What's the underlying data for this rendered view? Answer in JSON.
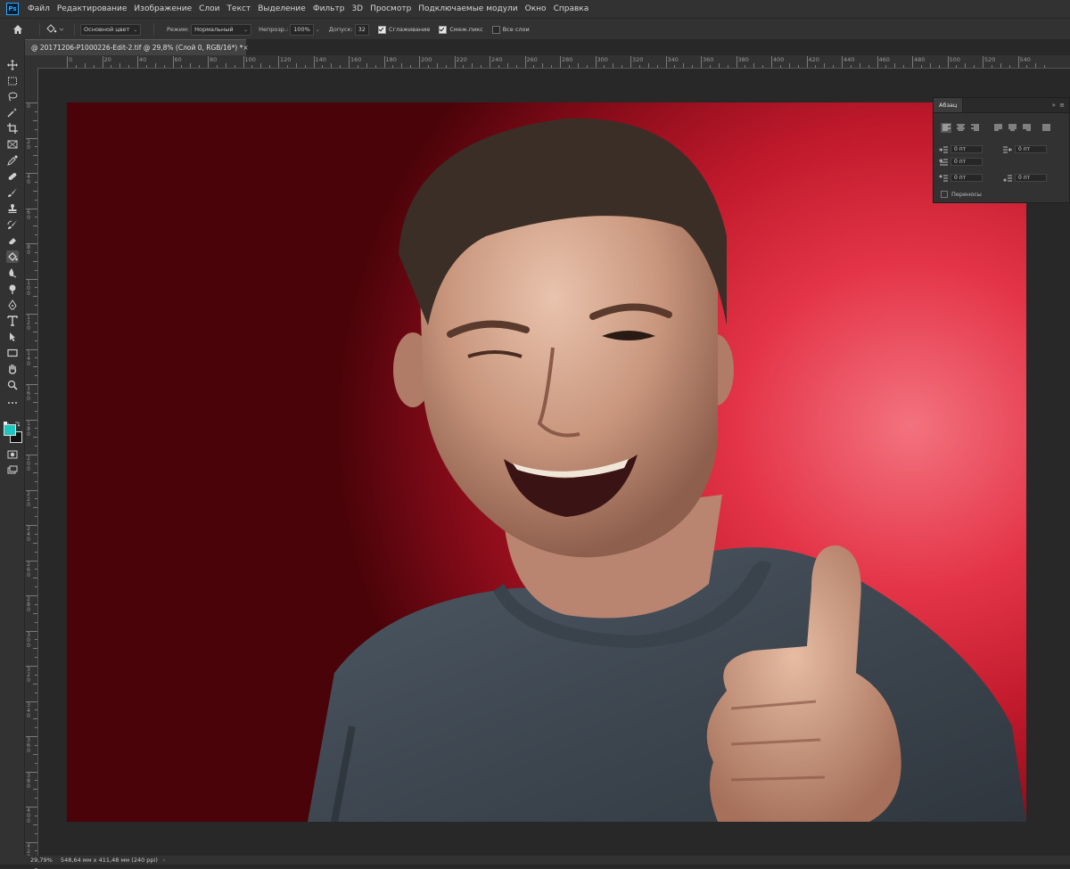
{
  "app": {
    "logo": "Ps"
  },
  "menu": [
    "Файл",
    "Редактирование",
    "Изображение",
    "Слои",
    "Текст",
    "Выделение",
    "Фильтр",
    "3D",
    "Просмотр",
    "Подключаемые модули",
    "Окно",
    "Справка"
  ],
  "options": {
    "source": "Основной цвет",
    "mode_label": "Режим:",
    "mode_value": "Нормальный",
    "opacity_label": "Непрозр.:",
    "opacity_value": "100%",
    "tolerance_label": "Допуск:",
    "tolerance_value": "32",
    "antialias_label": "Сглаживание",
    "antialias_checked": true,
    "contiguous_label": "Смеж.пикс",
    "contiguous_checked": true,
    "all_layers_label": "Все слои",
    "all_layers_checked": false
  },
  "document": {
    "tab_title": "@ 20171206-P1000226-Edit-2.tif @ 29,8% (Слой 0, RGB/16*) *",
    "close": "×"
  },
  "ruler": {
    "top_labels": [
      "0",
      "20",
      "40",
      "60",
      "80",
      "100",
      "120",
      "140",
      "160",
      "180",
      "200",
      "220",
      "240",
      "260",
      "280",
      "300",
      "320",
      "340",
      "360",
      "380",
      "400",
      "420",
      "440",
      "460",
      "480",
      "500",
      "520",
      "540"
    ],
    "left_labels": [
      "0",
      "20",
      "40",
      "60",
      "80",
      "100",
      "120",
      "140",
      "160",
      "180",
      "200",
      "220",
      "240",
      "260",
      "280",
      "300",
      "320",
      "340",
      "360",
      "380",
      "400",
      "420",
      "440"
    ]
  },
  "tools": [
    "move-icon",
    "marquee-icon",
    "lasso-icon",
    "magic-wand-icon",
    "crop-icon",
    "frame-icon",
    "eyedropper-icon",
    "healing-icon",
    "brush-icon",
    "stamp-icon",
    "history-brush-icon",
    "eraser-icon",
    "paint-bucket-icon",
    "blur-icon",
    "dodge-icon",
    "pen-icon",
    "type-icon",
    "path-select-icon",
    "rectangle-icon",
    "hand-icon",
    "zoom-icon",
    "more-icon"
  ],
  "colors": {
    "foreground": "#1ec6c0",
    "background": "#111111",
    "accent": "#31a8ff"
  },
  "paragraph_panel": {
    "title": "Абзац",
    "indent_left": "0 пт",
    "indent_right": "0 пт",
    "indent_first": "0 пт",
    "space_before": "0 пт",
    "space_after": "0 пт",
    "hyphenate_label": "Переносы"
  },
  "status": {
    "zoom": "29,79%",
    "info": "548,64 мм x 411,48 мм (240 ppi)",
    "arrow": "›"
  }
}
